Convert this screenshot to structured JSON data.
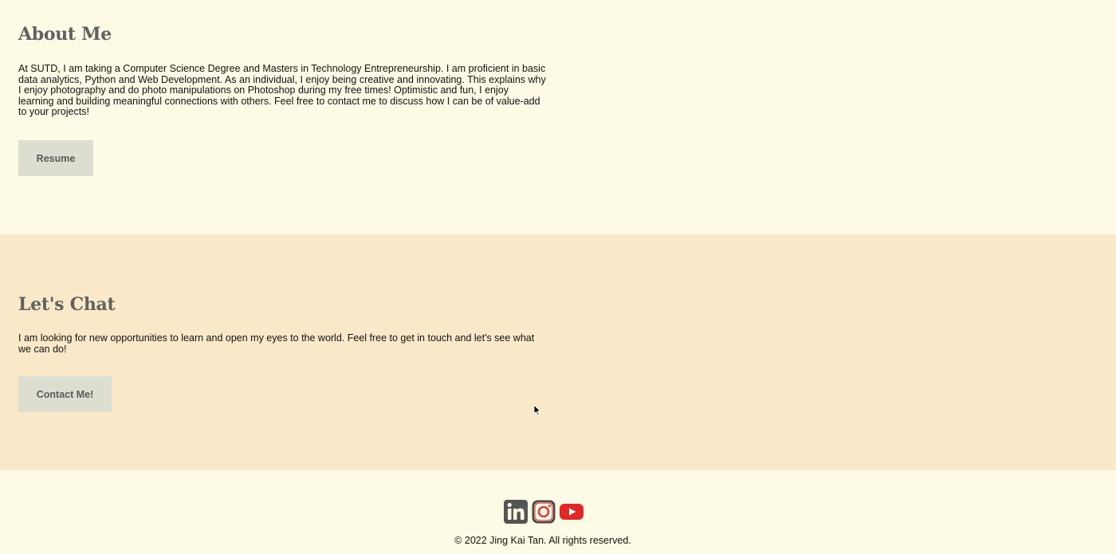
{
  "about": {
    "title": "About Me",
    "body": "At SUTD, I am taking a Computer Science Degree and Masters in Technology Entrepreneurship. I am proficient in basic data analytics, Python and Web Development. As an individual, I enjoy being creative and innovating. This explains why I enjoy photography and do photo manipulations on Photoshop during my free times! Optimistic and fun, I enjoy learning and building meaningful connections with others. Feel free to contact me to discuss how I can be of value-add to your projects!",
    "button_label": "Resume"
  },
  "chat": {
    "title": "Let's Chat",
    "body": "I am looking for new opportunities to learn and open my eyes to the world. Feel free to get in touch and let's see what we can do!",
    "button_label": "Contact Me!"
  },
  "footer": {
    "socials": [
      {
        "icon": "linkedin-icon",
        "color": "#555555"
      },
      {
        "icon": "instagram-icon",
        "color": "#e03a3a"
      },
      {
        "icon": "youtube-icon",
        "color": "#e32626"
      }
    ],
    "copyright": "© 2022 Jing Kai Tan. All rights reserved."
  },
  "colors": {
    "page_background": "#fdfbe6",
    "chat_background": "#f9e9c8",
    "button_background": "#dcdfcf",
    "heading_text": "#616161"
  }
}
